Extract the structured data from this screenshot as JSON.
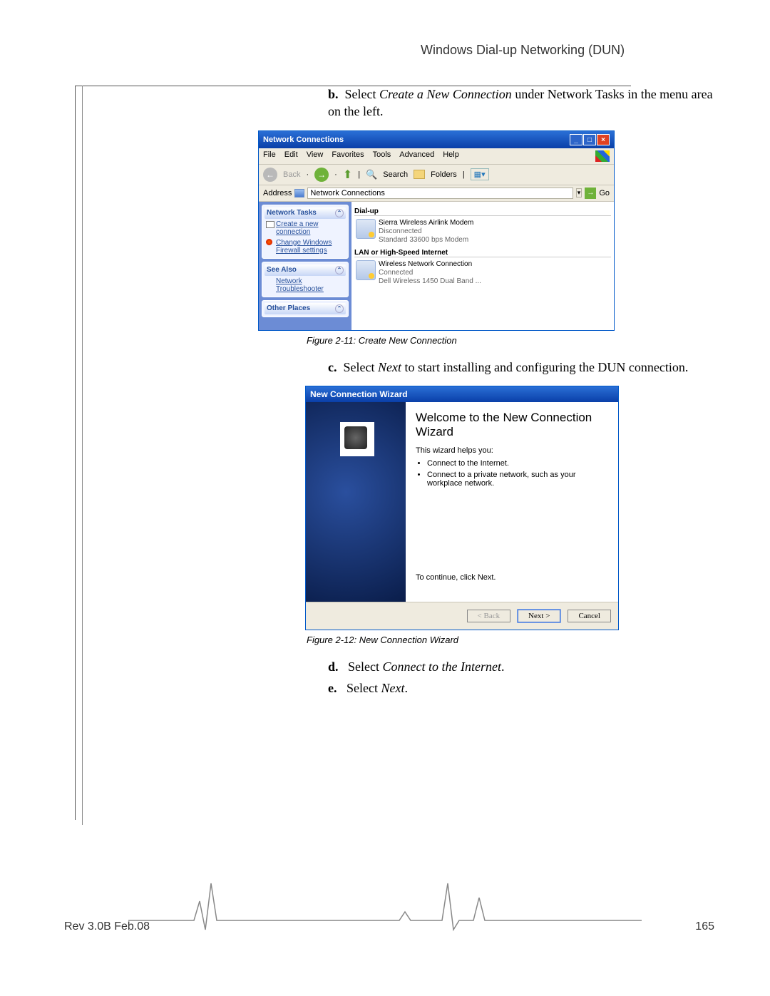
{
  "header": {
    "title": "Windows Dial-up Networking (DUN)"
  },
  "footer": {
    "rev": "Rev 3.0B Feb.08",
    "page": "165"
  },
  "steps": {
    "b": {
      "label": "b.",
      "text": "Select ",
      "em": "Create a New Connection",
      "rest": " under Network Tasks in the menu area on the left."
    },
    "c": {
      "label": "c.",
      "text": "Select ",
      "em": "Next",
      "rest": " to start installing and configuring the DUN connection."
    },
    "d": {
      "label": "d.",
      "text": "Select ",
      "em": "Connect to the Internet",
      "rest": "."
    },
    "e": {
      "label": "e.",
      "text": "Select ",
      "em": "Next",
      "rest": "."
    }
  },
  "captions": {
    "f1": "Figure 2-11: Create New Connection",
    "f2": "Figure 2-12: New Connection Wizard"
  },
  "win1": {
    "title": "Network Connections",
    "menu": [
      "File",
      "Edit",
      "View",
      "Favorites",
      "Tools",
      "Advanced",
      "Help"
    ],
    "toolbar": {
      "back": "Back",
      "search": "Search",
      "folders": "Folders"
    },
    "address": {
      "label": "Address",
      "value": "Network Connections",
      "go": "Go"
    },
    "sidebar": {
      "ntasks": {
        "title": "Network Tasks",
        "items": [
          "Create a new connection",
          "Change Windows Firewall settings"
        ]
      },
      "seealso": {
        "title": "See Also",
        "items": [
          "Network Troubleshooter"
        ]
      },
      "other": {
        "title": "Other Places"
      }
    },
    "groups": {
      "dialup": {
        "title": "Dial-up",
        "name": "Sierra Wireless Airlink Modem",
        "status": "Disconnected",
        "device": "Standard 33600 bps Modem"
      },
      "lan": {
        "title": "LAN or High-Speed Internet",
        "name": "Wireless Network Connection",
        "status": "Connected",
        "device": "Dell Wireless 1450 Dual Band ..."
      }
    }
  },
  "win2": {
    "title": "New Connection Wizard",
    "heading": "Welcome to the New Connection Wizard",
    "intro": "This wizard helps you:",
    "bullets": [
      "Connect to the Internet.",
      "Connect to a private network, such as your workplace network."
    ],
    "cont": "To continue, click Next.",
    "buttons": {
      "back": "< Back",
      "next": "Next >",
      "cancel": "Cancel"
    }
  }
}
